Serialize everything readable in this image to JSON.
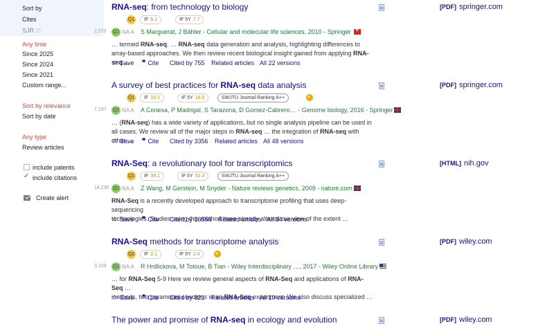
{
  "sidebar": {
    "sort_by": "Sort by",
    "cites": "Cites",
    "sjr": "SJR",
    "any_time": "Any time",
    "since_2025": "Since 2025",
    "since_2024": "Since 2024",
    "since_2021": "Since 2021",
    "custom_range": "Custom range...",
    "sort_by_relevance": "Sort by relevance",
    "sort_by_date": "Sort by date",
    "any_type": "Any type",
    "review_articles": "Review articles",
    "include_patents": "include patents",
    "include_citations": "include citations",
    "create_alert": "Create alert"
  },
  "actions": {
    "save": "Save",
    "cite": "Cite",
    "related": "Related articles"
  },
  "labels": {
    "naa": "NA A",
    "q1": "Q1",
    "q2": "Q2",
    "if": "IF",
    "if5y": "IF 5Y",
    "swjtu": "SWJTU Journal Ranking A++"
  },
  "results": [
    {
      "title_bold": "RNA-seq",
      "title_rest": ": from technology to biology",
      "pdf_tag": "[PDF]",
      "pdf_domain": "springer.com",
      "quartile": "Q1",
      "if": "6.2",
      "if5y": "7.7",
      "cite_num": "2,273",
      "authors": "S Marguerat, J Bähler - Cellular and molecular life sciences, 2010 - Springer",
      "snippet1": "… termed RNA-seq. … RNA-seq data generation and analysis, highlighting differences to",
      "snippet2": "array-based approaches. We then review recent biological insight gained from applying RNA-seq …",
      "cited_by": "Cited by 755",
      "versions": "All 22 versions"
    },
    {
      "title_pre": "A survey of best practices for ",
      "title_bold": "RNA-seq",
      "title_rest": " data analysis",
      "pdf_tag": "[PDF]",
      "pdf_domain": "springer.com",
      "quartile": "Q1",
      "if": "10.1",
      "if5y": "16.5",
      "cite_num": "7,197",
      "authors": "A Conesa, P Madrigal, S Tarazona, D Gomez-Cabrero… - Genome biology, 2016 - Springer",
      "snippet1": "… (RNA-seq) has a wide variety of applications, but no single analysis pipeline can be used in",
      "snippet2": "all cases. We review all of the major steps in RNA-seq … the integration of RNA-seq with other …",
      "cited_by": "Cited by 3356",
      "versions": "All 48 versions"
    },
    {
      "title_bold": "RNA-Seq",
      "title_rest": ": a revolutionary tool for transcriptomics",
      "pdf_tag": "[HTML]",
      "pdf_domain": "nih.gov",
      "quartile": "Q1",
      "if": "39.1",
      "if5y": "52.3",
      "cite_num": "14,236",
      "authors": "Z Wang, M Gerstein, M Snyder - Nature reviews genetics, 2009 - nature.com",
      "snippet1": "RNA-Seq is a recently developed approach to transcriptome profiling that uses deep-sequencing",
      "snippet2": "technologies. Studies using this method have already altered our view of the extent …",
      "cited_by": "Cited by 16556",
      "versions": "All 34 versions"
    },
    {
      "title_bold": "RNA-Seq",
      "title_rest": " methods for transcriptome analysis",
      "pdf_tag": "[PDF]",
      "pdf_domain": "wiley.com",
      "quartile": "Q2",
      "if": "2.1",
      "if5y": "2.4",
      "cite_num": "3,109",
      "authors": "R Hrdlickova, M Toloue, B Tian - Wiley Interdisciplinary …, 2017 - Wiley Online Library",
      "snippet1": "… for RNA-Seq 5-9 Here we review general aspects of RNA-Seq and applications of RNA-Seq …",
      "snippet2": "methods, two paramount concerns in an RNA-Seq experiment. We also discuss specialized …",
      "cited_by": "Cited by 821",
      "versions": "All 10 versions"
    },
    {
      "title_pre": "The power and promise of ",
      "title_bold": "RNA-seq",
      "title_rest": " in ecology and evolution",
      "pdf_tag": "[PDF]",
      "pdf_domain": "wiley.com"
    }
  ]
}
